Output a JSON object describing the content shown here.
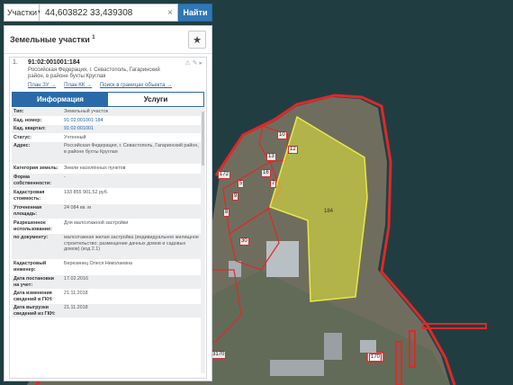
{
  "search": {
    "type_label": "Участки",
    "query": "44,603822 33,439308",
    "find_label": "Найти",
    "clear_glyph": "×"
  },
  "panel": {
    "title": "Земельные участки",
    "count": "1",
    "star_glyph": "★"
  },
  "result": {
    "index": "1.",
    "cadastral": "91:02:001001:184",
    "address": "Российская Федерация, г. Севастополь, Гагаринский район, в районе бухты Круглая",
    "icons": "⚠ ✎ ▸",
    "links": [
      "План ЗУ →",
      "План КК →",
      "Поиск в границах объекта →"
    ],
    "tabs": [
      {
        "label": "Информация",
        "active": true
      },
      {
        "label": "Услуги",
        "active": false
      }
    ],
    "fields": [
      {
        "k": "Тип:",
        "v": "Земельный участок"
      },
      {
        "k": "Кад. номер:",
        "v": "91:02:001001:184",
        "link": true
      },
      {
        "k": "Кад. квартал:",
        "v": "91:02:001001",
        "link": true
      },
      {
        "k": "Статус:",
        "v": "Учтенный"
      },
      {
        "k": "Адрес:",
        "v": "Российская Федерация, г. Севастополь, Гагаринский район, в районе бухты Круглая"
      },
      {
        "k": "Категория земель:",
        "v": "Земли населённых пунктов"
      },
      {
        "k": "Форма собственности:",
        "v": "-"
      },
      {
        "k": "Кадастровая стоимость:",
        "v": "133 855 901,52 руб."
      },
      {
        "k": "Уточненная площадь:",
        "v": "24 084 кв. м"
      },
      {
        "k": "Разрешенное использование:",
        "v": "Для малоэтажной застройки"
      },
      {
        "k": "по документу:",
        "v": "малоэтажная жилая застройка (индивидуальное жилищное строительство; размещение дачных домов и садовых домов) (код 2.1)"
      },
      {
        "k": "Кадастровый инженер:",
        "v": "Березинец Олеся Николаевна"
      },
      {
        "k": "Дата постановки на учет:",
        "v": "17.02.2016"
      },
      {
        "k": "Дата изменения сведений в ГКН:",
        "v": "21.11.2018"
      },
      {
        "k": "Дата выгрузки сведений из ГКН:",
        "v": "21.11.2018"
      }
    ]
  },
  "map": {
    "highlight_label": "184",
    "parcel_labels": [
      "10",
      "12",
      "13",
      "16",
      "172",
      "5",
      "7",
      "9",
      "8",
      "30",
      "180",
      "132",
      "3170",
      "170"
    ],
    "colors": {
      "sea": "#1f3a3f",
      "parcel": "#e0e13a",
      "border": "#e02828"
    }
  }
}
